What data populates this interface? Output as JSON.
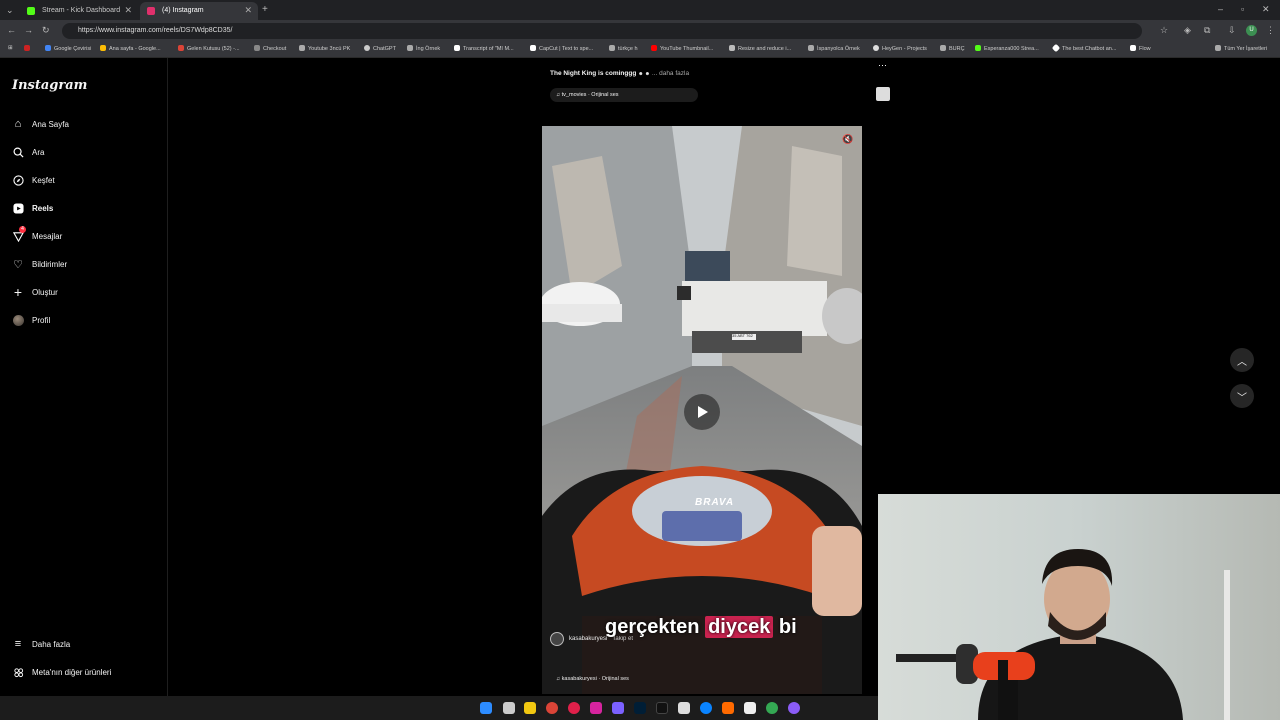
{
  "browser": {
    "tabs": [
      {
        "label": "Stream - Kick Dashboard",
        "color": "#53fc18"
      },
      {
        "label": "(4) Instagram",
        "color": "#e1306c"
      }
    ],
    "url": "https://www.instagram.com/reels/DS7Wdp8CD35/",
    "bookmarks": [
      "Google Çevirisi",
      "Ana sayfa - Google...",
      "Gelen Kutusu (52) -...",
      "Checkout",
      "Youtube 3ncü PK",
      "ChatGPT",
      "İng Örnek",
      "Transcript of \"MI M...",
      "CapCut | Text to spe...",
      "türkçe h",
      "YouTube Thumbnail...",
      "Resize and reduce i...",
      "İspanyolca Örnek",
      "HeyGen - Projects",
      "BURÇ",
      "Esperanza000 Strea...",
      "The best Chatbot an...",
      "Flow",
      "Tüm Yer İşaretleri"
    ]
  },
  "sidebar": {
    "logo": "Instagram",
    "items": [
      {
        "label": "Ana Sayfa",
        "icon": "home-icon"
      },
      {
        "label": "Ara",
        "icon": "search-icon"
      },
      {
        "label": "Keşfet",
        "icon": "compass-icon"
      },
      {
        "label": "Reels",
        "icon": "reels-icon"
      },
      {
        "label": "Mesajlar",
        "icon": "messenger-icon",
        "badge": "4"
      },
      {
        "label": "Bildirimler",
        "icon": "heart-icon"
      },
      {
        "label": "Oluştur",
        "icon": "plus-icon"
      },
      {
        "label": "Profil",
        "icon": "avatar-icon"
      }
    ],
    "bottom": [
      {
        "label": "Daha fazla",
        "icon": "menu-icon"
      },
      {
        "label": "Meta'nın diğer ürünleri",
        "icon": "meta-icon"
      }
    ]
  },
  "reel_prev": {
    "caption": "The Night King is cominggg",
    "more": "... daha fazla",
    "audio": "tv_movies · Orijinal ses"
  },
  "reel": {
    "subtitle_a": "gerçekten",
    "subtitle_b": "diycek",
    "subtitle_c": "bi",
    "username": "kasabakuryesi",
    "follow": "Takip et",
    "audio": "kasabakuryesi · Orijinal ses",
    "scooter_brand": "BRAVA",
    "plate": "35 ABT 762"
  },
  "colors": {
    "accent": "#ff3040",
    "highlight": "#c9234f"
  }
}
